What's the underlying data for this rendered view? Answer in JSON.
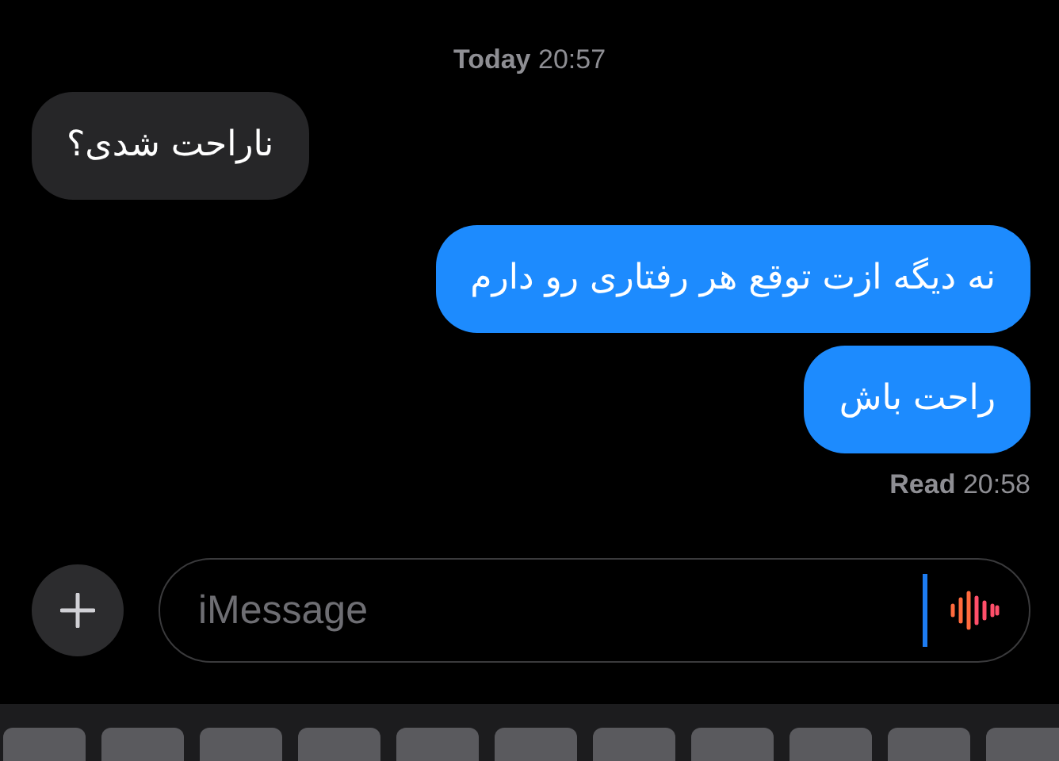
{
  "timestamp": {
    "day": "Today",
    "time": "20:57"
  },
  "messages": [
    {
      "kind": "incoming",
      "text": "ناراحت شدی؟"
    },
    {
      "kind": "outgoing",
      "text": "نه دیگه ازت توقع هر رفتاری رو دارم"
    },
    {
      "kind": "outgoing",
      "text": "راحت باش"
    }
  ],
  "receipt": {
    "status": "Read",
    "time": "20:58"
  },
  "composer": {
    "placeholder": "iMessage"
  }
}
